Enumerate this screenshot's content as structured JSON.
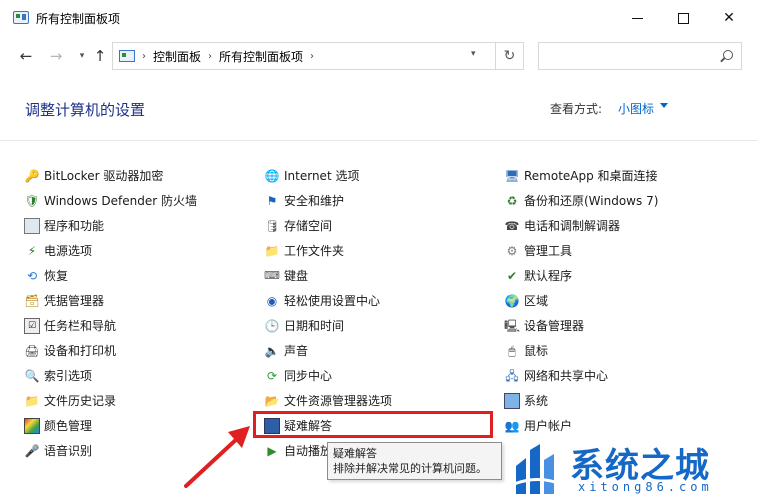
{
  "window": {
    "title": "所有控制面板项",
    "minimize_glyph": "",
    "close_glyph": "✕"
  },
  "nav": {
    "back": "←",
    "forward": "→",
    "dropdown": "▾",
    "up": "↑",
    "breadcrumb": [
      "控制面板",
      "所有控制面板项"
    ],
    "crumb_sep": "›",
    "addr_dropdown": "▾",
    "refresh": "↻",
    "search_placeholder": ""
  },
  "header": {
    "title": "调整计算机的设置",
    "view_label": "查看方式:",
    "view_value": "小图标"
  },
  "columns": [
    [
      {
        "label": "BitLocker 驱动器加密",
        "icon": "key-icon",
        "glyph": "🔑"
      },
      {
        "label": "Windows Defender 防火墙",
        "icon": "firewall-icon",
        "glyph": "🛡"
      },
      {
        "label": "程序和功能",
        "icon": "programs-icon",
        "glyph": ""
      },
      {
        "label": "电源选项",
        "icon": "power-icon",
        "glyph": "⚡"
      },
      {
        "label": "恢复",
        "icon": "recovery-icon",
        "glyph": "⟲"
      },
      {
        "label": "凭据管理器",
        "icon": "credential-icon",
        "glyph": "🗃"
      },
      {
        "label": "任务栏和导航",
        "icon": "taskbar-icon",
        "glyph": "☑"
      },
      {
        "label": "设备和打印机",
        "icon": "printer-icon",
        "glyph": "🖨"
      },
      {
        "label": "索引选项",
        "icon": "index-icon",
        "glyph": "🔍"
      },
      {
        "label": "文件历史记录",
        "icon": "file-history-icon",
        "glyph": "📁"
      },
      {
        "label": "颜色管理",
        "icon": "color-icon",
        "glyph": ""
      },
      {
        "label": "语音识别",
        "icon": "speech-icon",
        "glyph": "🎤"
      }
    ],
    [
      {
        "label": "Internet 选项",
        "icon": "internet-icon",
        "glyph": "🌐"
      },
      {
        "label": "安全和维护",
        "icon": "flag-icon",
        "glyph": "⚑"
      },
      {
        "label": "存储空间",
        "icon": "storage-icon",
        "glyph": "🛢"
      },
      {
        "label": "工作文件夹",
        "icon": "work-folder-icon",
        "glyph": "📁"
      },
      {
        "label": "键盘",
        "icon": "keyboard-icon",
        "glyph": "⌨"
      },
      {
        "label": "轻松使用设置中心",
        "icon": "accessibility-icon",
        "glyph": "◉"
      },
      {
        "label": "日期和时间",
        "icon": "clock-icon",
        "glyph": "🕒"
      },
      {
        "label": "声音",
        "icon": "sound-icon",
        "glyph": "🔈"
      },
      {
        "label": "同步中心",
        "icon": "sync-icon",
        "glyph": "⟳"
      },
      {
        "label": "文件资源管理器选项",
        "icon": "folder-options-icon",
        "glyph": "📂"
      },
      {
        "label": "疑难解答",
        "icon": "troubleshoot-icon",
        "glyph": ""
      },
      {
        "label": "自动播放",
        "icon": "autoplay-icon",
        "glyph": "▶"
      }
    ],
    [
      {
        "label": "RemoteApp 和桌面连接",
        "icon": "remoteapp-icon",
        "glyph": "🖥"
      },
      {
        "label": "备份和还原(Windows 7)",
        "icon": "backup-icon",
        "glyph": "♻"
      },
      {
        "label": "电话和调制解调器",
        "icon": "phone-icon",
        "glyph": "☎"
      },
      {
        "label": "管理工具",
        "icon": "admin-tools-icon",
        "glyph": "⚙"
      },
      {
        "label": "默认程序",
        "icon": "default-programs-icon",
        "glyph": "✔"
      },
      {
        "label": "区域",
        "icon": "region-icon",
        "glyph": "🌍"
      },
      {
        "label": "设备管理器",
        "icon": "device-manager-icon",
        "glyph": "🖳"
      },
      {
        "label": "鼠标",
        "icon": "mouse-icon",
        "glyph": "🖱"
      },
      {
        "label": "网络和共享中心",
        "icon": "network-icon",
        "glyph": "🖧"
      },
      {
        "label": "系统",
        "icon": "system-icon",
        "glyph": ""
      },
      {
        "label": "用户帐户",
        "icon": "user-icon",
        "glyph": "👥"
      }
    ]
  ],
  "tooltip": {
    "title": "疑难解答",
    "description": "排除并解决常见的计算机问题。"
  },
  "watermark": {
    "text": "系统之城",
    "url": "xitong86.com"
  },
  "colors": {
    "title_blue": "#1e3287",
    "link_blue": "#0066cc",
    "highlight_red": "#e02020",
    "watermark_blue": "#1668c6"
  }
}
